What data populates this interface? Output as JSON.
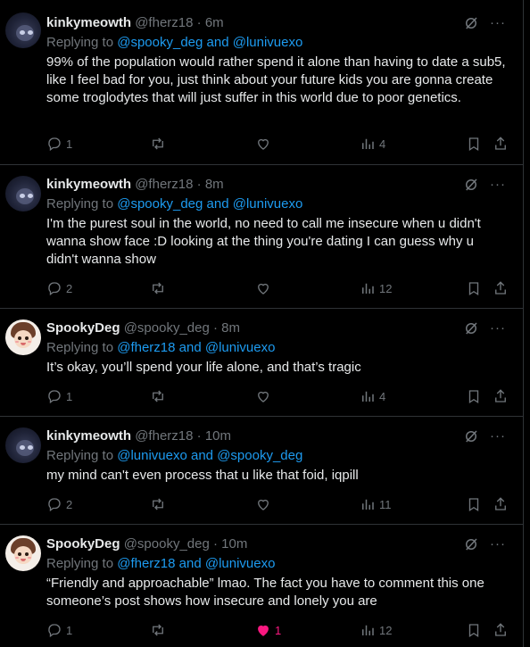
{
  "reply_prefix": "Replying to",
  "and_word": "and",
  "separator": "·",
  "more_label": "···",
  "tweets": [
    {
      "name": "kinkymeowth",
      "handle": "@fherz18",
      "time": "6m",
      "mentions": [
        "@spooky_deg",
        "@lunivuexo"
      ],
      "text": "99% of the population would rather spend it alone than having to date a sub5, like I feel bad for you, just think about your future kids you are gonna create some troglodytes that will just suffer in this world due to poor genetics.",
      "replies": "1",
      "retweets": "",
      "likes": "",
      "views": "4",
      "liked": false
    },
    {
      "name": "kinkymeowth",
      "handle": "@fherz18",
      "time": "8m",
      "mentions": [
        "@spooky_deg",
        "@lunivuexo"
      ],
      "text": "I'm the purest soul in the world, no need to call me insecure when u didn't wanna show face :D looking at the thing you're dating I can guess why u didn't wanna show",
      "replies": "2",
      "retweets": "",
      "likes": "",
      "views": "12",
      "liked": false
    },
    {
      "name": "SpookyDeg",
      "handle": "@spooky_deg",
      "time": "8m",
      "mentions": [
        "@fherz18",
        "@lunivuexo"
      ],
      "text": "It’s okay, you’ll spend your life alone, and that’s tragic",
      "replies": "1",
      "retweets": "",
      "likes": "",
      "views": "4",
      "liked": false
    },
    {
      "name": "kinkymeowth",
      "handle": "@fherz18",
      "time": "10m",
      "mentions": [
        "@lunivuexo",
        "@spooky_deg"
      ],
      "text": "my mind can't even process that u like that foid, iqpill",
      "replies": "2",
      "retweets": "",
      "likes": "",
      "views": "11",
      "liked": false
    },
    {
      "name": "SpookyDeg",
      "handle": "@spooky_deg",
      "time": "10m",
      "mentions": [
        "@fherz18",
        "@lunivuexo"
      ],
      "text": "“Friendly and approachable” lmao. The fact you have to comment this one someone’s post shows how insecure and lonely you are",
      "replies": "1",
      "retweets": "",
      "likes": "1",
      "views": "12",
      "liked": true
    }
  ],
  "colors": {
    "background": "#000000",
    "text": "#e7e9ea",
    "muted": "#71767b",
    "link": "#1d9bf0",
    "like": "#f91880",
    "border": "#2f3336"
  },
  "icons": {
    "reply": "reply-icon",
    "retweet": "retweet-icon",
    "like": "heart-icon",
    "views": "views-icon",
    "bookmark": "bookmark-icon",
    "share": "share-icon",
    "grok": "grok-icon"
  }
}
